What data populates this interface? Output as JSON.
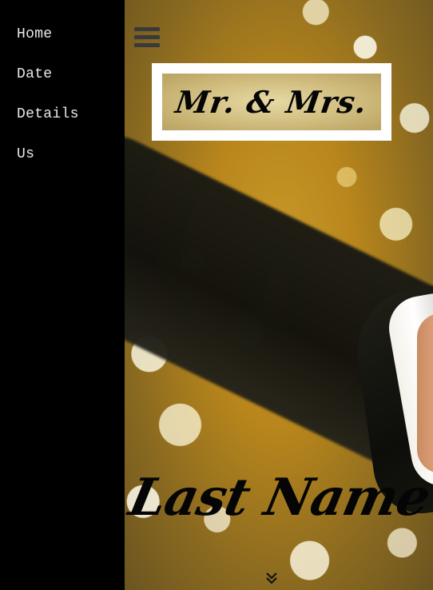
{
  "sidebar": {
    "items": [
      {
        "label": "Home"
      },
      {
        "label": "Date"
      },
      {
        "label": "Details"
      },
      {
        "label": "Us"
      }
    ]
  },
  "header": {
    "menu_icon": "hamburger-menu-icon",
    "logo_text": "Mr. & Mrs."
  },
  "hero": {
    "title": "Last Name",
    "scroll_icon": "double-chevron-down-icon"
  },
  "colors": {
    "sidebar_bg": "#000000",
    "nav_text": "#e8e8e8",
    "logo_frame": "#ffffff",
    "title_text": "#050505"
  }
}
